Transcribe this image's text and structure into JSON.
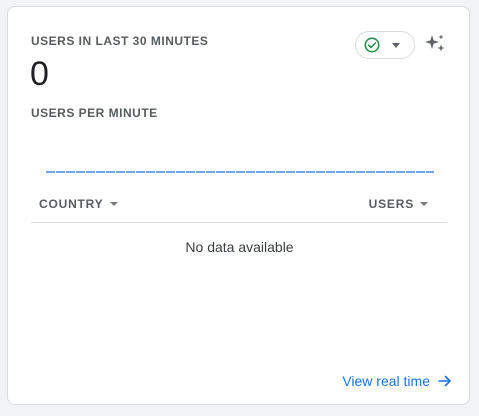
{
  "card": {
    "metric_label": "USERS IN LAST 30 MINUTES",
    "metric_value": "0",
    "sub_label": "USERS PER MINUTE",
    "status_icon": "check-circle-icon",
    "assist_icon": "sparkle-icon"
  },
  "table": {
    "columns": [
      {
        "label": "COUNTRY"
      },
      {
        "label": "USERS"
      }
    ],
    "empty_message": "No data available"
  },
  "footer": {
    "view_link_label": "View real time",
    "view_link_icon": "arrow-right-icon"
  },
  "colors": {
    "accent": "#1a73e8",
    "status_green": "#1e8e3e",
    "sparkline": "#1a73e8"
  }
}
